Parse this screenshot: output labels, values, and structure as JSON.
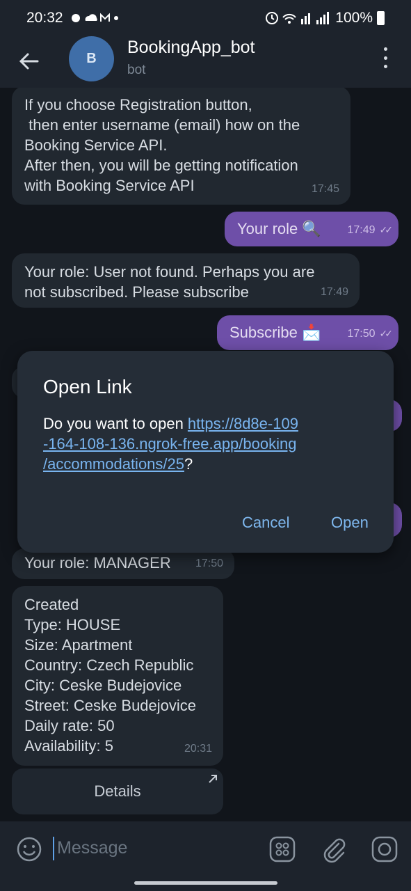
{
  "status": {
    "time": "20:32",
    "battery": "100%"
  },
  "header": {
    "avatar_letter": "B",
    "title": "BookingApp_bot",
    "subtitle": "bot"
  },
  "messages": [
    {
      "dir": "in",
      "lines": [
        "If you choose Registration button,",
        " then enter username (email) how on the",
        "Booking Service API.",
        "After then, you will be getting notification",
        "with Booking Service API"
      ],
      "time": "17:45"
    },
    {
      "dir": "out",
      "text": "Your role 🔍",
      "time": "17:49"
    },
    {
      "dir": "in",
      "lines": [
        "Your role: User not found. Perhaps you are",
        "not subscribed. Please subscribe"
      ],
      "time": "17:49"
    },
    {
      "dir": "out",
      "text": "Subscribe 📩",
      "time": "17:50"
    },
    {
      "dir": "in",
      "text": "Your role: MANAGER",
      "time": "17:50"
    },
    {
      "dir": "in",
      "lines": [
        "Created",
        "Type: HOUSE",
        "Size: Apartment",
        "Country: Czech Republic",
        "City: Ceske Budejovice",
        "Street: Ceske Budejovice",
        "Daily rate: 50",
        "Availability: 5"
      ],
      "time": "20:31"
    }
  ],
  "details_button": "Details",
  "dialog": {
    "title": "Open Link",
    "prefix": "Do you want to open ",
    "url": "https://8d8e-109-164-108-136.ngrok-free.app/booking/accommodations/25",
    "url_line1": "https://8d8e-109",
    "url_line2": "-164-108-136.ngrok-free.app/booking",
    "url_line3": "/accommodations/25",
    "suffix": "?",
    "cancel": "Cancel",
    "open": "Open"
  },
  "input": {
    "placeholder": "Message"
  },
  "icons": {
    "back": "arrow-left-icon",
    "menu": "more-vert-icon",
    "emoji": "emoji-icon",
    "keyboard": "bot-keyboard-icon",
    "attach": "paperclip-icon",
    "camera": "camera-icon"
  }
}
